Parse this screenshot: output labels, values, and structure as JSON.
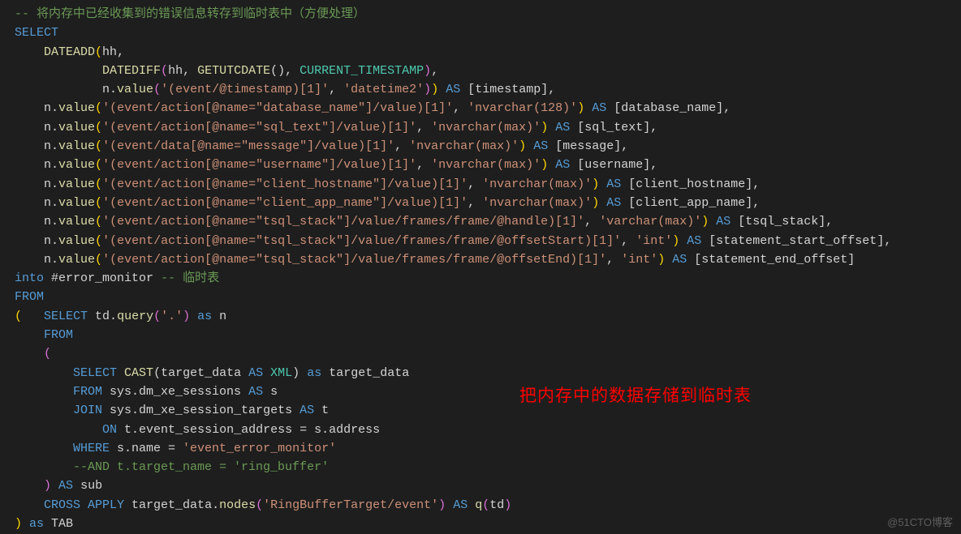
{
  "code_lines": [
    {
      "indent": "",
      "segs": [
        [
          "cm",
          "-- 将内存中已经收集到的错误信息转存到临时表中（方便处理）"
        ]
      ]
    },
    {
      "indent": "",
      "segs": [
        [
          "kw",
          "SELECT"
        ]
      ]
    },
    {
      "indent": "    ",
      "segs": [
        [
          "fn",
          "DATEADD"
        ],
        [
          "br",
          "("
        ],
        [
          "id",
          "hh"
        ],
        [
          "op",
          ","
        ]
      ]
    },
    {
      "indent": "            ",
      "segs": [
        [
          "fn",
          "DATEDIFF"
        ],
        [
          "br2",
          "("
        ],
        [
          "id",
          "hh"
        ],
        [
          "op",
          ", "
        ],
        [
          "fn",
          "GETUTCDATE"
        ],
        [
          "id",
          "()"
        ],
        [
          "op",
          ", "
        ],
        [
          "gl",
          "CURRENT_TIMESTAMP"
        ],
        [
          "br2",
          ")"
        ],
        [
          "op",
          ","
        ]
      ]
    },
    {
      "indent": "            ",
      "segs": [
        [
          "id",
          "n."
        ],
        [
          "fn",
          "value"
        ],
        [
          "br2",
          "("
        ],
        [
          "st",
          "'(event/@timestamp)[1]'"
        ],
        [
          "op",
          ", "
        ],
        [
          "st",
          "'datetime2'"
        ],
        [
          "br2",
          ")"
        ],
        [
          "br",
          ")"
        ],
        [
          "op",
          " "
        ],
        [
          "kw",
          "AS"
        ],
        [
          "op",
          " ["
        ],
        [
          "id",
          "timestamp"
        ],
        [
          "op",
          "],"
        ]
      ]
    },
    {
      "indent": "    ",
      "segs": [
        [
          "id",
          "n."
        ],
        [
          "fn",
          "value"
        ],
        [
          "br",
          "("
        ],
        [
          "st",
          "'(event/action[@name=\"database_name\"]/value)[1]'"
        ],
        [
          "op",
          ", "
        ],
        [
          "st",
          "'nvarchar(128)'"
        ],
        [
          "br",
          ")"
        ],
        [
          "op",
          " "
        ],
        [
          "kw",
          "AS"
        ],
        [
          "op",
          " ["
        ],
        [
          "id",
          "database_name"
        ],
        [
          "op",
          "],"
        ]
      ]
    },
    {
      "indent": "    ",
      "segs": [
        [
          "id",
          "n."
        ],
        [
          "fn",
          "value"
        ],
        [
          "br",
          "("
        ],
        [
          "st",
          "'(event/action[@name=\"sql_text\"]/value)[1]'"
        ],
        [
          "op",
          ", "
        ],
        [
          "st",
          "'nvarchar(max)'"
        ],
        [
          "br",
          ")"
        ],
        [
          "op",
          " "
        ],
        [
          "kw",
          "AS"
        ],
        [
          "op",
          " ["
        ],
        [
          "id",
          "sql_text"
        ],
        [
          "op",
          "],"
        ]
      ]
    },
    {
      "indent": "    ",
      "segs": [
        [
          "id",
          "n."
        ],
        [
          "fn",
          "value"
        ],
        [
          "br",
          "("
        ],
        [
          "st",
          "'(event/data[@name=\"message\"]/value)[1]'"
        ],
        [
          "op",
          ", "
        ],
        [
          "st",
          "'nvarchar(max)'"
        ],
        [
          "br",
          ")"
        ],
        [
          "op",
          " "
        ],
        [
          "kw",
          "AS"
        ],
        [
          "op",
          " ["
        ],
        [
          "id",
          "message"
        ],
        [
          "op",
          "],"
        ]
      ]
    },
    {
      "indent": "    ",
      "segs": [
        [
          "id",
          "n."
        ],
        [
          "fn",
          "value"
        ],
        [
          "br",
          "("
        ],
        [
          "st",
          "'(event/action[@name=\"username\"]/value)[1]'"
        ],
        [
          "op",
          ", "
        ],
        [
          "st",
          "'nvarchar(max)'"
        ],
        [
          "br",
          ")"
        ],
        [
          "op",
          " "
        ],
        [
          "kw",
          "AS"
        ],
        [
          "op",
          " ["
        ],
        [
          "id",
          "username"
        ],
        [
          "op",
          "],"
        ]
      ]
    },
    {
      "indent": "    ",
      "segs": [
        [
          "id",
          "n."
        ],
        [
          "fn",
          "value"
        ],
        [
          "br",
          "("
        ],
        [
          "st",
          "'(event/action[@name=\"client_hostname\"]/value)[1]'"
        ],
        [
          "op",
          ", "
        ],
        [
          "st",
          "'nvarchar(max)'"
        ],
        [
          "br",
          ")"
        ],
        [
          "op",
          " "
        ],
        [
          "kw",
          "AS"
        ],
        [
          "op",
          " ["
        ],
        [
          "id",
          "client_hostname"
        ],
        [
          "op",
          "],"
        ]
      ]
    },
    {
      "indent": "    ",
      "segs": [
        [
          "id",
          "n."
        ],
        [
          "fn",
          "value"
        ],
        [
          "br",
          "("
        ],
        [
          "st",
          "'(event/action[@name=\"client_app_name\"]/value)[1]'"
        ],
        [
          "op",
          ", "
        ],
        [
          "st",
          "'nvarchar(max)'"
        ],
        [
          "br",
          ")"
        ],
        [
          "op",
          " "
        ],
        [
          "kw",
          "AS"
        ],
        [
          "op",
          " ["
        ],
        [
          "id",
          "client_app_name"
        ],
        [
          "op",
          "],"
        ]
      ]
    },
    {
      "indent": "    ",
      "segs": [
        [
          "id",
          "n."
        ],
        [
          "fn",
          "value"
        ],
        [
          "br",
          "("
        ],
        [
          "st",
          "'(event/action[@name=\"tsql_stack\"]/value/frames/frame/@handle)[1]'"
        ],
        [
          "op",
          ", "
        ],
        [
          "st",
          "'varchar(max)'"
        ],
        [
          "br",
          ")"
        ],
        [
          "op",
          " "
        ],
        [
          "kw",
          "AS"
        ],
        [
          "op",
          " ["
        ],
        [
          "id",
          "tsql_stack"
        ],
        [
          "op",
          "],"
        ]
      ]
    },
    {
      "indent": "    ",
      "segs": [
        [
          "id",
          "n."
        ],
        [
          "fn",
          "value"
        ],
        [
          "br",
          "("
        ],
        [
          "st",
          "'(event/action[@name=\"tsql_stack\"]/value/frames/frame/@offsetStart)[1]'"
        ],
        [
          "op",
          ", "
        ],
        [
          "st",
          "'int'"
        ],
        [
          "br",
          ")"
        ],
        [
          "op",
          " "
        ],
        [
          "kw",
          "AS"
        ],
        [
          "op",
          " ["
        ],
        [
          "id",
          "statement_start_offset"
        ],
        [
          "op",
          "],"
        ]
      ]
    },
    {
      "indent": "    ",
      "segs": [
        [
          "id",
          "n."
        ],
        [
          "fn",
          "value"
        ],
        [
          "br",
          "("
        ],
        [
          "st",
          "'(event/action[@name=\"tsql_stack\"]/value/frames/frame/@offsetEnd)[1]'"
        ],
        [
          "op",
          ", "
        ],
        [
          "st",
          "'int'"
        ],
        [
          "br",
          ")"
        ],
        [
          "op",
          " "
        ],
        [
          "kw",
          "AS"
        ],
        [
          "op",
          " ["
        ],
        [
          "id",
          "statement_end_offset"
        ],
        [
          "op",
          "]"
        ]
      ]
    },
    {
      "indent": "",
      "segs": [
        [
          "kw",
          "into"
        ],
        [
          "op",
          " "
        ],
        [
          "id",
          "#error_monitor "
        ],
        [
          "cm",
          "-- 临时表"
        ]
      ]
    },
    {
      "indent": "",
      "segs": [
        [
          "kw",
          "FROM"
        ]
      ]
    },
    {
      "indent": "",
      "segs": [
        [
          "br",
          "("
        ],
        [
          "op",
          "   "
        ],
        [
          "kw",
          "SELECT"
        ],
        [
          "op",
          " td."
        ],
        [
          "fn",
          "query"
        ],
        [
          "br2",
          "("
        ],
        [
          "st",
          "'.'"
        ],
        [
          "br2",
          ")"
        ],
        [
          "op",
          " "
        ],
        [
          "kw",
          "as"
        ],
        [
          "op",
          " n"
        ]
      ]
    },
    {
      "indent": "    ",
      "segs": [
        [
          "kw",
          "FROM"
        ]
      ]
    },
    {
      "indent": "    ",
      "segs": [
        [
          "br2",
          "("
        ]
      ]
    },
    {
      "indent": "        ",
      "segs": [
        [
          "kw",
          "SELECT"
        ],
        [
          "op",
          " "
        ],
        [
          "fn",
          "CAST"
        ],
        [
          "id",
          "("
        ],
        [
          "id",
          "target_data "
        ],
        [
          "kw",
          "AS"
        ],
        [
          "op",
          " "
        ],
        [
          "gl",
          "XML"
        ],
        [
          "id",
          ")"
        ],
        [
          "op",
          " "
        ],
        [
          "kw",
          "as"
        ],
        [
          "op",
          " target_data"
        ]
      ]
    },
    {
      "indent": "        ",
      "segs": [
        [
          "kw",
          "FROM"
        ],
        [
          "op",
          " sys.dm_xe_sessions "
        ],
        [
          "kw",
          "AS"
        ],
        [
          "op",
          " s"
        ]
      ]
    },
    {
      "indent": "        ",
      "segs": [
        [
          "kw",
          "JOIN"
        ],
        [
          "op",
          " sys.dm_xe_session_targets "
        ],
        [
          "kw",
          "AS"
        ],
        [
          "op",
          " t"
        ]
      ]
    },
    {
      "indent": "            ",
      "segs": [
        [
          "kw",
          "ON"
        ],
        [
          "op",
          " t.event_session_address = s.address"
        ]
      ]
    },
    {
      "indent": "        ",
      "segs": [
        [
          "kw",
          "WHERE"
        ],
        [
          "op",
          " s.name = "
        ],
        [
          "st",
          "'event_error_monitor'"
        ]
      ]
    },
    {
      "indent": "        ",
      "segs": [
        [
          "cm",
          "--AND t.target_name = 'ring_buffer'"
        ]
      ]
    },
    {
      "indent": "    ",
      "segs": [
        [
          "br2",
          ")"
        ],
        [
          "op",
          " "
        ],
        [
          "kw",
          "AS"
        ],
        [
          "op",
          " sub"
        ]
      ]
    },
    {
      "indent": "    ",
      "segs": [
        [
          "kw",
          "CROSS APPLY"
        ],
        [
          "op",
          " target_data."
        ],
        [
          "fn",
          "nodes"
        ],
        [
          "br2",
          "("
        ],
        [
          "st",
          "'RingBufferTarget/event'"
        ],
        [
          "br2",
          ")"
        ],
        [
          "op",
          " "
        ],
        [
          "kw",
          "AS"
        ],
        [
          "op",
          " "
        ],
        [
          "fn",
          "q"
        ],
        [
          "br2",
          "("
        ],
        [
          "id",
          "td"
        ],
        [
          "br2",
          ")"
        ]
      ]
    },
    {
      "indent": "",
      "segs": [
        [
          "br",
          ")"
        ],
        [
          "op",
          " "
        ],
        [
          "kw",
          "as"
        ],
        [
          "op",
          " TAB"
        ]
      ]
    }
  ],
  "annotation": "把内存中的数据存储到临时表",
  "watermark": "@51CTO博客"
}
